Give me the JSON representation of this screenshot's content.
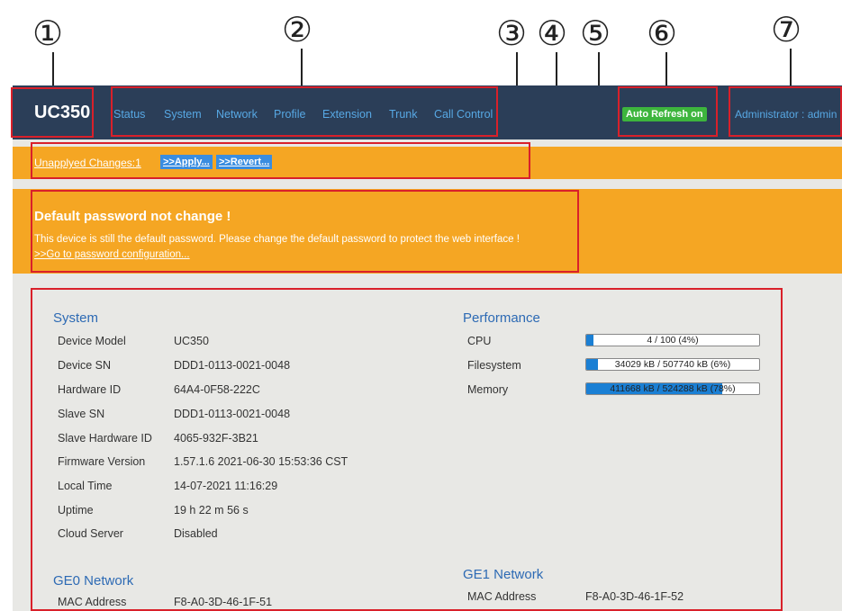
{
  "callouts": [
    "①",
    "②",
    "③",
    "④",
    "⑤",
    "⑥",
    "⑦"
  ],
  "header": {
    "logo": "UC350",
    "nav": [
      "Status",
      "System",
      "Network",
      "Profile",
      "Extension",
      "Trunk",
      "Call Control"
    ],
    "auto_refresh": "Auto Refresh on",
    "admin": "Administrator : admin"
  },
  "unapplied": {
    "text": "Unapplyed Changes:1",
    "apply": ">>Apply...",
    "revert": ">>Revert..."
  },
  "warning": {
    "title": "Default password not change !",
    "message": "This device is still the default password. Please change the default password to protect the web interface !",
    "link": ">>Go to password configuration..."
  },
  "system": {
    "title": "System",
    "rows": [
      {
        "label": "Device Model",
        "value": "UC350"
      },
      {
        "label": "Device SN",
        "value": "DDD1-0113-0021-0048"
      },
      {
        "label": "Hardware ID",
        "value": "64A4-0F58-222C"
      },
      {
        "label": "Slave SN",
        "value": "DDD1-0113-0021-0048"
      },
      {
        "label": "Slave Hardware ID",
        "value": "4065-932F-3B21"
      },
      {
        "label": "Firmware Version",
        "value": "1.57.1.6 2021-06-30 15:53:36 CST"
      },
      {
        "label": "Local Time",
        "value": "14-07-2021 11:16:29"
      },
      {
        "label": "Uptime",
        "value": "19 h 22 m 56 s"
      },
      {
        "label": "Cloud Server",
        "value": "Disabled"
      }
    ]
  },
  "performance": {
    "title": "Performance",
    "rows": [
      {
        "label": "CPU",
        "text": "4 / 100 (4%)",
        "fraction": 0.04
      },
      {
        "label": "Filesystem",
        "text": "34029 kB / 507740 kB (6%)",
        "fraction": 0.067
      },
      {
        "label": "Memory",
        "text": "411668 kB / 524288 kB (78%)",
        "fraction": 0.785
      }
    ]
  },
  "ge0": {
    "title": "GE0 Network",
    "label": "MAC Address",
    "value": "F8-A0-3D-46-1F-51"
  },
  "ge1": {
    "title": "GE1 Network",
    "label": "MAC Address",
    "value": "F8-A0-3D-46-1F-52"
  },
  "colors": {
    "navbar": "#2b3e58",
    "nav_link": "#57a8e4",
    "orange": "#f5a623",
    "green": "#3db53d",
    "blue": "#1a7fd4",
    "callout_red": "#d9202a",
    "content_bg": "#e8e8e5"
  }
}
